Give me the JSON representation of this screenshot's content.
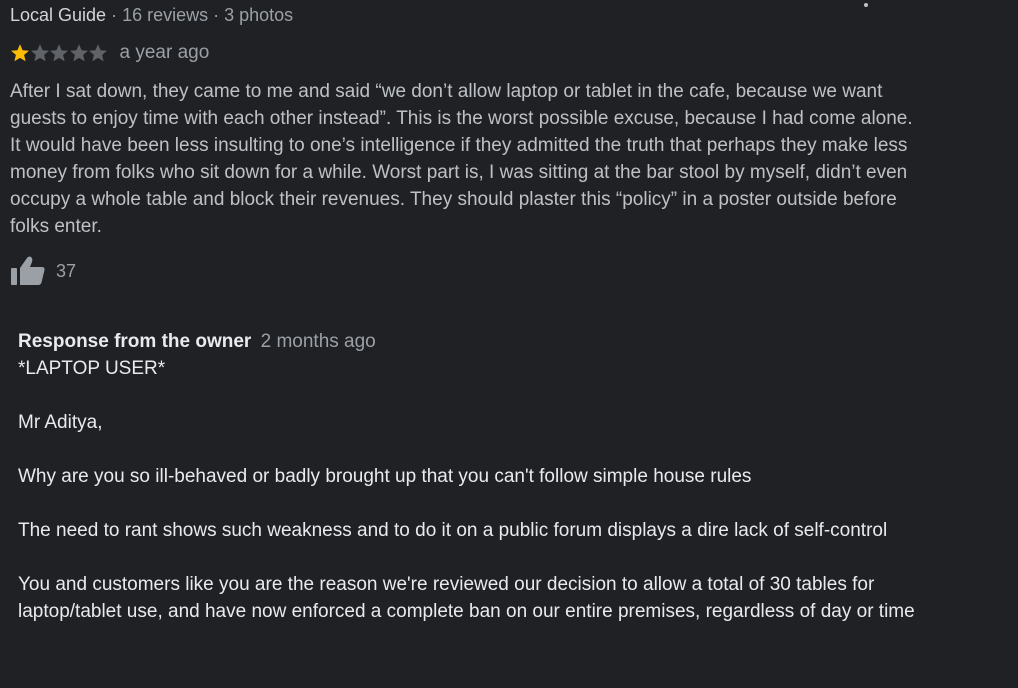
{
  "reviewer": {
    "badge": "Local Guide",
    "reviews": "16 reviews",
    "photos": "3 photos",
    "separator": " · "
  },
  "review": {
    "rating": 1,
    "max_rating": 5,
    "date": "a year ago",
    "text": "After I sat down, they came to me and said “we don’t allow laptop or tablet in the cafe, because we want guests to enjoy time with each other instead”. This is the worst possible excuse, because I had come alone. It would have been less insulting to one’s intelligence if they admitted the truth that perhaps they make less money from folks who sit down for a while. Worst part is, I was sitting at the bar stool by myself, didn’t even occupy a whole table and block their revenues. They should plaster this “policy” in a poster outside before folks enter.",
    "likes": "37"
  },
  "owner_response": {
    "label": "Response from the owner",
    "date": "2 months ago",
    "lines": [
      "*LAPTOP USER*",
      "Mr Aditya,",
      "Why are you so ill-behaved or badly brought up that you can't follow simple house rules",
      "The need to rant shows such weakness and to do it on a public forum displays a dire lack of self-control",
      "You and customers like you are the reason we're reviewed our decision to allow a total of 30 tables for laptop/tablet use, and have now enforced a complete ban on our entire premises, regardless of day or time"
    ]
  },
  "colors": {
    "background": "#202124",
    "star_filled": "#fbbc04",
    "star_empty": "#5f6368",
    "text_primary": "#e8eaed",
    "text_secondary": "#9aa0a6",
    "text_body": "#bdc1c6"
  },
  "icons": {
    "more": "more-vert-icon",
    "like": "thumbs-up-icon",
    "star": "star-icon"
  }
}
